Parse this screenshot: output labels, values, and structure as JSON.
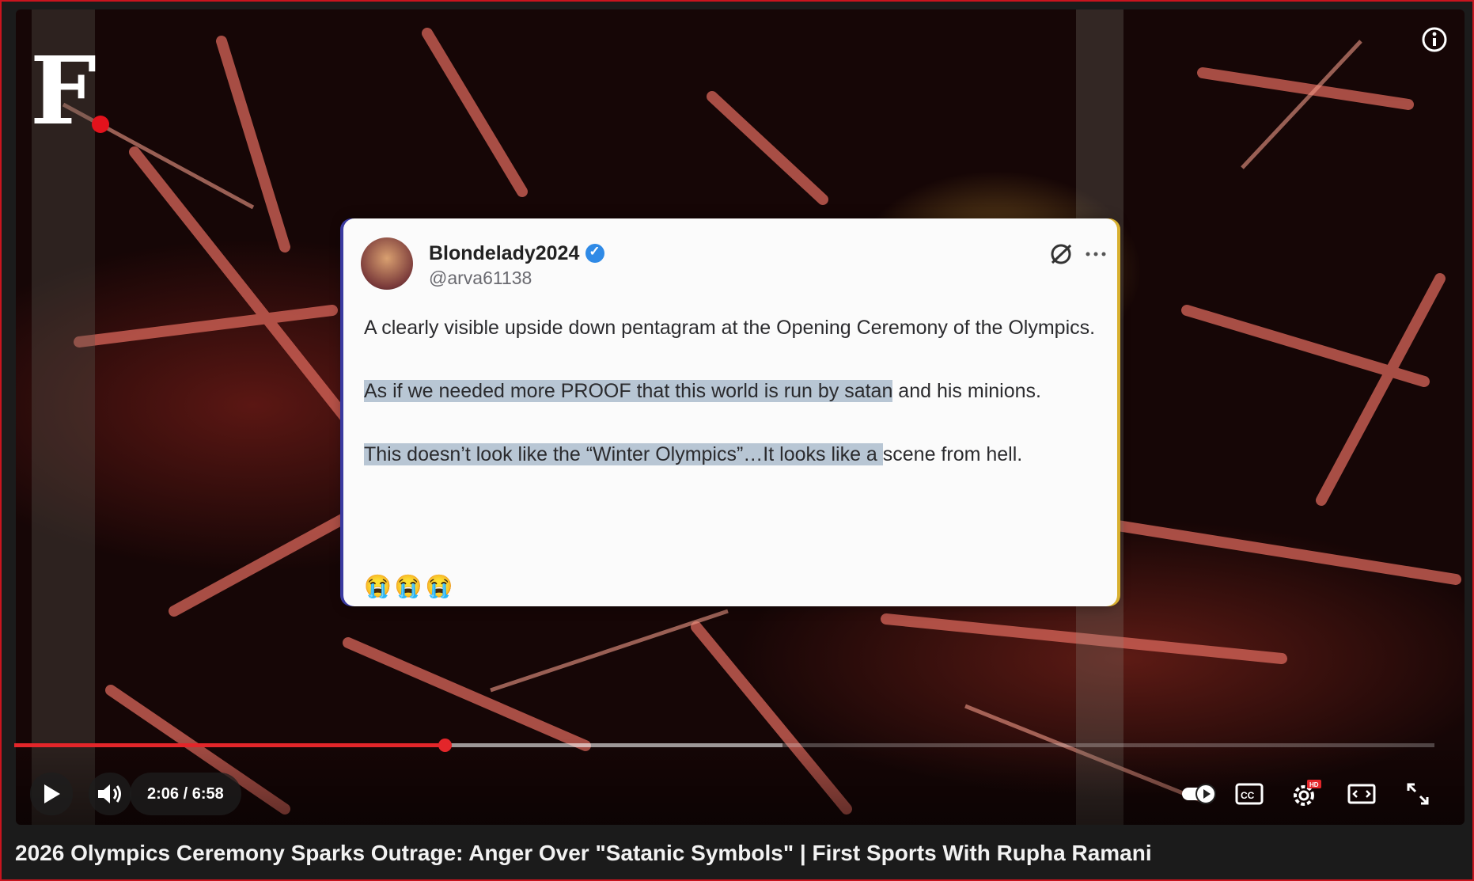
{
  "logo": {
    "letter": "F"
  },
  "tweet": {
    "username": "Blondelady2024",
    "handle": "@arva61138",
    "paragraph1": "A clearly visible upside down pentagram at the Opening Ceremony of the Olympics.",
    "paragraph2_highlighted": "As if we needed more PROOF that this world is run by satan",
    "paragraph2_rest": " and his minions.",
    "paragraph3_highlighted": "This doesn’t look like the “Winter Olympics”…It looks like a ",
    "paragraph3_rest": "scene from hell.",
    "emoji": "😭😭😭"
  },
  "player": {
    "time_display": "2:06 / 6:58",
    "played_fraction": 0.303,
    "buffered_fraction": 0.541,
    "hd_badge": "HD",
    "accent_color": "#e3262a"
  },
  "video_title": "2026 Olympics Ceremony Sparks Outrage: Anger Over \"Satanic Symbols\" | First Sports With Rupha Ramani",
  "icons": [
    "info-icon",
    "play-icon",
    "volume-icon",
    "autoplay-toggle-icon",
    "captions-icon",
    "settings-icon",
    "theater-mode-icon",
    "fullscreen-icon",
    "verified-badge-icon",
    "grok-icon",
    "more-icon"
  ]
}
